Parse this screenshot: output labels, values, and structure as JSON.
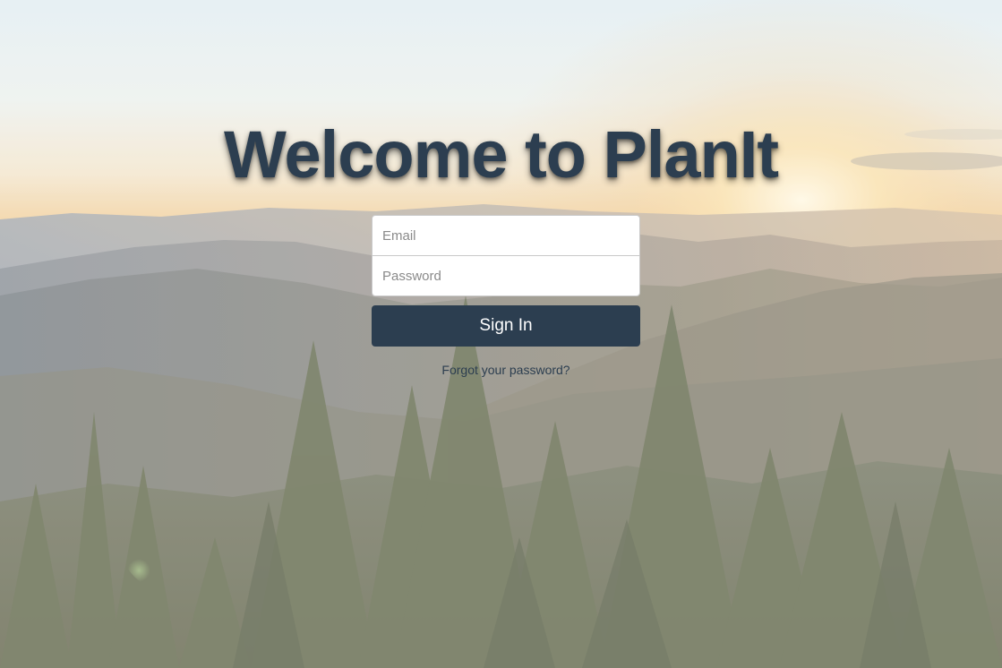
{
  "app": {
    "title": "Welcome to PlanIt"
  },
  "login": {
    "email_placeholder": "Email",
    "password_placeholder": "Password",
    "email_value": "",
    "password_value": "",
    "signin_label": "Sign In",
    "forgot_label": "Forgot your password?"
  },
  "colors": {
    "primary": "#2c3e50",
    "field_bg": "#ffffff",
    "field_border": "#c9c9c9"
  }
}
